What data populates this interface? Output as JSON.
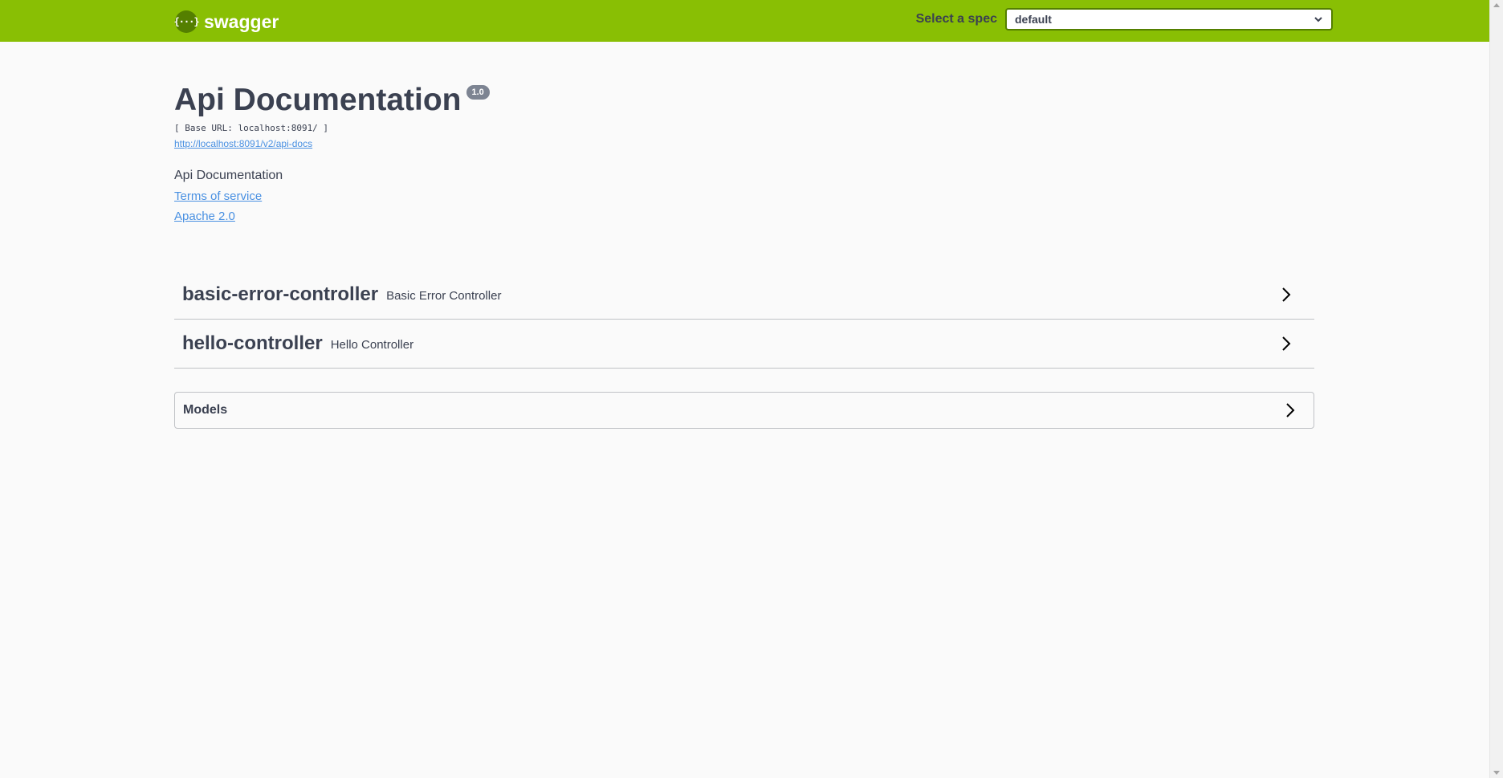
{
  "topbar": {
    "logo_glyph": "{···}",
    "brand": "swagger",
    "spec_label": "Select a spec",
    "spec_value": "default",
    "colors": {
      "bar": "#89bf04",
      "logo_bg": "#547f00"
    }
  },
  "info": {
    "title": "Api Documentation",
    "version": "1.0",
    "base_url": "[ Base URL: localhost:8091/ ]",
    "spec_url": "http://localhost:8091/v2/api-docs",
    "description": "Api Documentation",
    "terms": "Terms of service",
    "license": "Apache 2.0"
  },
  "tags": [
    {
      "name": "basic-error-controller",
      "description": "Basic Error Controller"
    },
    {
      "name": "hello-controller",
      "description": "Hello Controller"
    }
  ],
  "models": {
    "label": "Models"
  },
  "icons": {
    "logo": "swagger-logo-icon",
    "dropdown": "chevron-down-icon",
    "expand": "chevron-right-icon"
  }
}
